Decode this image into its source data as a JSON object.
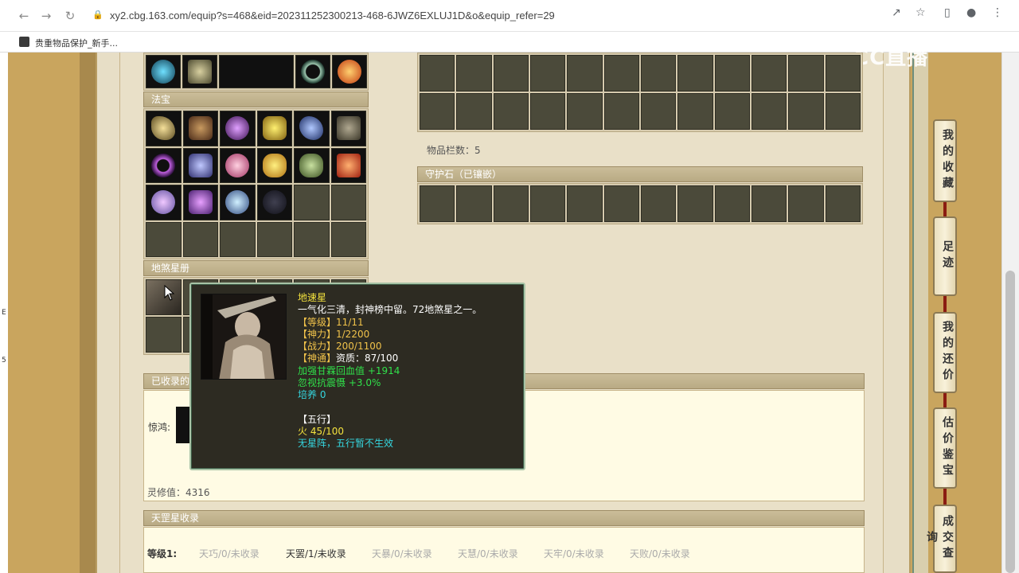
{
  "browser": {
    "url": "xy2.cbg.163.com/equip?s=468&eid=202311252300213-468-6JWZ6EXLUJ1D&o&equip_refer=29",
    "bookmark": "贵重物品保护_新手..."
  },
  "watermark": "CC直播",
  "left_edge_marks": [
    "E",
    "5"
  ],
  "sections": {
    "fabao": "法宝",
    "disha": "地煞星册",
    "collected": "已收录的",
    "tiangang": "天罡星收录",
    "guardian": "守护石（已镶嵌）"
  },
  "item_count_label": "物品栏数：5",
  "jinghong_label": "惊鸿:",
  "lingxiu": "灵修值：4316",
  "tiangang_row": {
    "level": "等级1:",
    "items": [
      "天巧/0/未收录",
      "天罢/1/未收录",
      "天暴/0/未收录",
      "天慧/0/未收录",
      "天牢/0/未收录",
      "天败/0/未收录"
    ]
  },
  "side_tabs": [
    "我的收藏",
    "足迹",
    "我的还价",
    "估价鉴宝",
    "成交查询"
  ],
  "tooltip": {
    "name": "地速星",
    "desc": "一气化三清，封神榜中留。72地煞星之一。",
    "level": "【等级】11/11",
    "shenli": "【神力】1/2200",
    "zhanli": "【战力】200/1100",
    "shentong_a": "【神通】",
    "shentong_b": "资质：87/100",
    "attr1": "加强甘霖回血值 +1914",
    "attr2": "忽视抗震慑 +3.0%",
    "peiyang": "培养 0",
    "wuxing_head": "【五行】",
    "wuxing_val": "火 45/100",
    "wuxing_note": "无星阵，五行暂不生效"
  },
  "colors": {
    "tooltip_bg": "#2d2b22",
    "tooltip_border": "#a7c3a6",
    "header_bar": "#b9aa84",
    "page_gold": "#c9a55e"
  }
}
